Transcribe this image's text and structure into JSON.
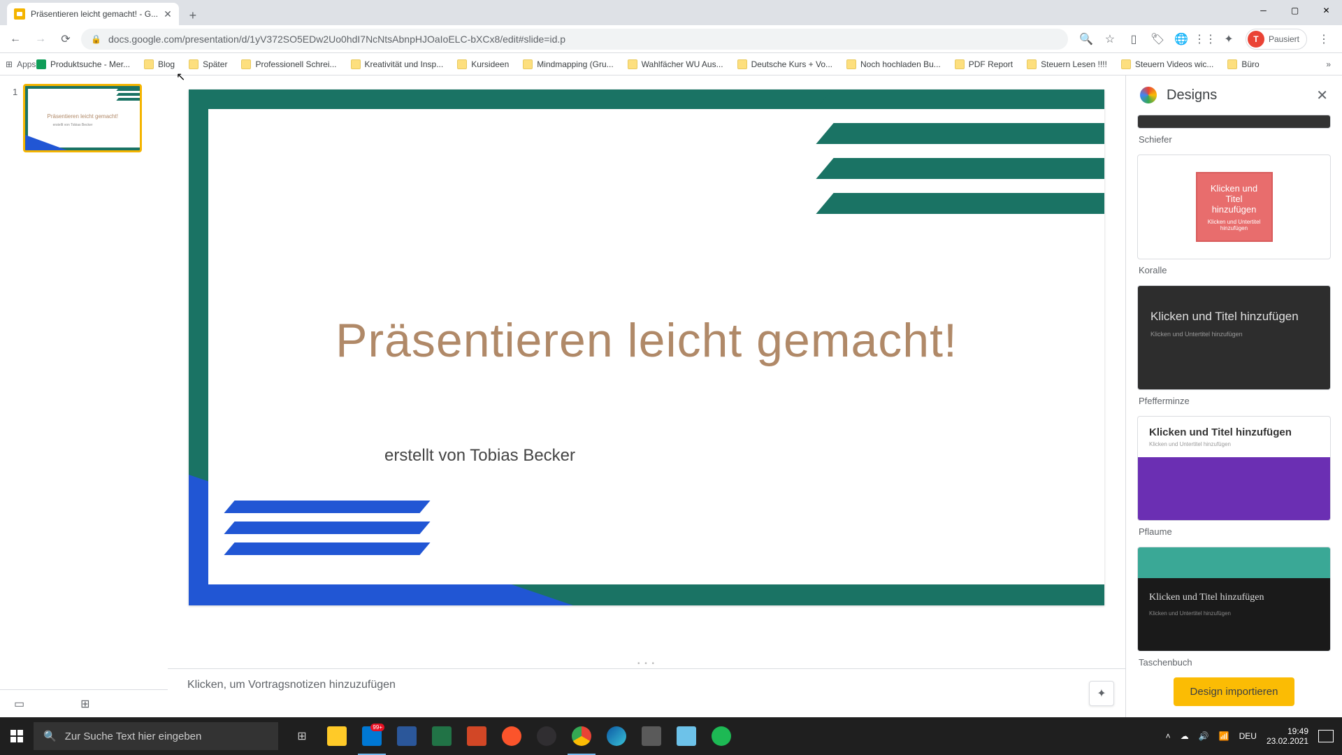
{
  "browser": {
    "tab_title": "Präsentieren leicht gemacht! - G...",
    "url": "docs.google.com/presentation/d/1yV372SO5EDw2Uo0hdI7NcNtsAbnpHJOaIoELC-bXCx8/edit#slide=id.p",
    "avatar_letter": "T",
    "avatar_status": "Pausiert"
  },
  "bookmarks": {
    "apps": "Apps",
    "items": [
      "Produktsuche - Mer...",
      "Blog",
      "Später",
      "Professionell Schrei...",
      "Kreativität und Insp...",
      "Kursideen",
      "Mindmapping  (Gru...",
      "Wahlfächer WU Aus...",
      "Deutsche Kurs + Vo...",
      "Noch hochladen Bu...",
      "PDF Report",
      "Steuern Lesen !!!!",
      "Steuern Videos wic...",
      "Büro"
    ]
  },
  "slide": {
    "number": "1",
    "title": "Präsentieren leicht gemacht!",
    "author": "erstellt von Tobias Becker",
    "notes_placeholder": "Klicken, um Vortragsnotizen hinzuzufügen"
  },
  "designs": {
    "panel_title": "Designs",
    "items": {
      "schiefer": "Schiefer",
      "koralle": "Koralle",
      "koralle_title": "Klicken und Titel hinzufügen",
      "koralle_sub": "Klicken und Untertitel hinzufügen",
      "pfeffer": "Pfefferminze",
      "pfeffer_title": "Klicken und Titel hinzufügen",
      "pfeffer_sub": "Klicken und Untertitel hinzufügen",
      "pflaume": "Pflaume",
      "pflaume_title": "Klicken und Titel hinzufügen",
      "pflaume_sub": "Klicken und Untertitel hinzufügen",
      "taschen": "Taschenbuch",
      "taschen_title": "Klicken und Titel hinzufügen",
      "taschen_sub": "Klicken und Untertitel hinzufügen"
    },
    "import_button": "Design importieren"
  },
  "taskbar": {
    "search_placeholder": "Zur Suche Text hier eingeben",
    "lang": "DEU",
    "time": "19:49",
    "date": "23.02.2021",
    "mail_badge": "99+"
  }
}
